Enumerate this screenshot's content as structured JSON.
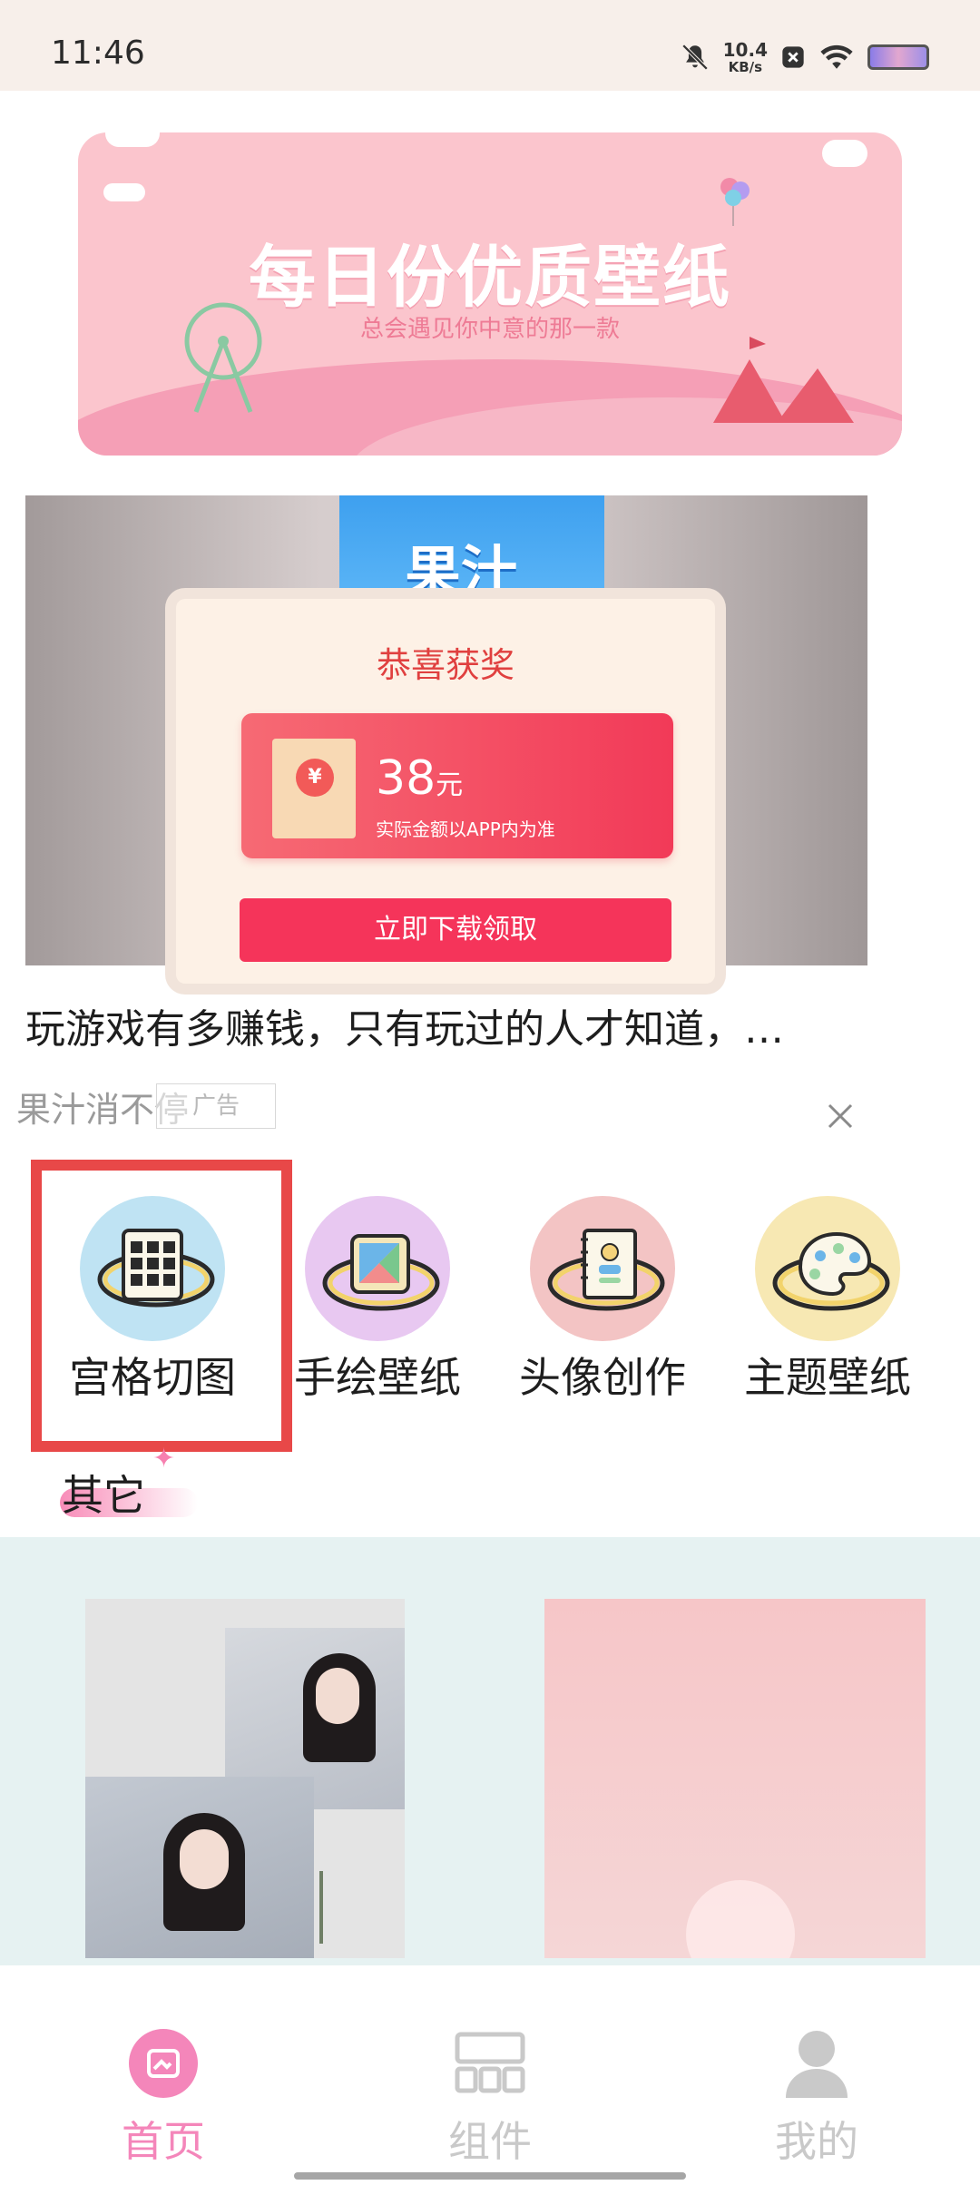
{
  "status_bar": {
    "time": "11:46",
    "net_speed_value": "10.4",
    "net_speed_unit": "KB/s",
    "icons": [
      "bell-off-icon",
      "notification-x-icon",
      "wifi-icon",
      "battery-icon"
    ]
  },
  "banner": {
    "title": "每日份优质壁纸",
    "subtitle": "总会遇见你中意的那一款"
  },
  "ad": {
    "game_art_text": "果汁",
    "prize_title": "恭喜获奖",
    "prize_amount": "38",
    "prize_unit": "元",
    "prize_note": "实际金额以APP内为准",
    "prize_button": "立即下载领取",
    "headline": "玩游戏有多赚钱，只有玩过的人才知道，…",
    "sub_title": "果汁消不停",
    "badge": "广告"
  },
  "tools": [
    {
      "label": "宫格切图",
      "icon": "grid-cut-icon",
      "color": "#bfe3f3"
    },
    {
      "label": "手绘壁纸",
      "icon": "hand-drawn-icon",
      "color": "#e8c8f1"
    },
    {
      "label": "头像创作",
      "icon": "avatar-create-icon",
      "color": "#f3c4c4"
    },
    {
      "label": "主题壁纸",
      "icon": "theme-palette-icon",
      "color": "#f7e8b3"
    }
  ],
  "section": {
    "title": "其它"
  },
  "nav": {
    "items": [
      {
        "label": "首页",
        "icon": "home-icon",
        "active": true
      },
      {
        "label": "组件",
        "icon": "widgets-icon",
        "active": false
      },
      {
        "label": "我的",
        "icon": "profile-icon",
        "active": false
      }
    ],
    "active_color": "#f486ba",
    "inactive_color": "#c9c9c9"
  }
}
